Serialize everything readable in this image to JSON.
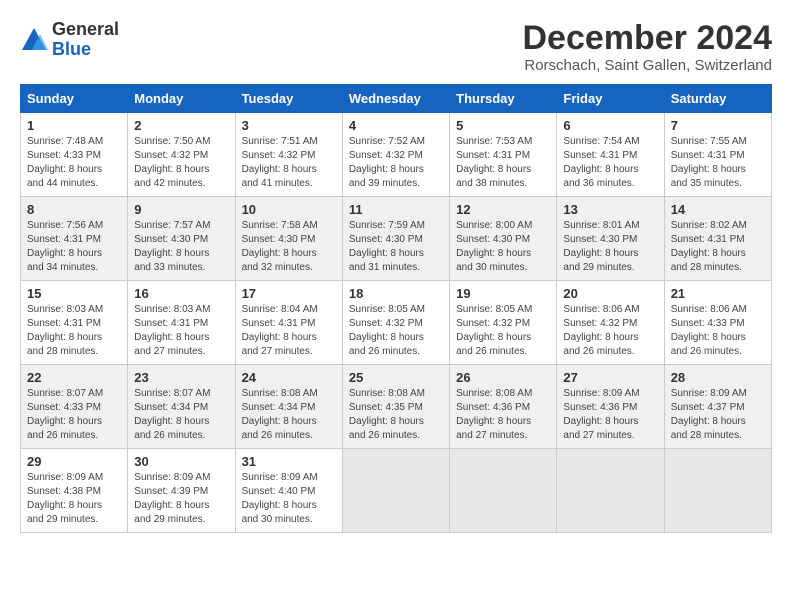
{
  "logo": {
    "general": "General",
    "blue": "Blue"
  },
  "header": {
    "month_title": "December 2024",
    "location": "Rorschach, Saint Gallen, Switzerland"
  },
  "days_of_week": [
    "Sunday",
    "Monday",
    "Tuesday",
    "Wednesday",
    "Thursday",
    "Friday",
    "Saturday"
  ],
  "weeks": [
    {
      "days": [
        {
          "num": "1",
          "sunrise": "7:48 AM",
          "sunset": "4:33 PM",
          "daylight": "8 hours and 44 minutes."
        },
        {
          "num": "2",
          "sunrise": "7:50 AM",
          "sunset": "4:32 PM",
          "daylight": "8 hours and 42 minutes."
        },
        {
          "num": "3",
          "sunrise": "7:51 AM",
          "sunset": "4:32 PM",
          "daylight": "8 hours and 41 minutes."
        },
        {
          "num": "4",
          "sunrise": "7:52 AM",
          "sunset": "4:32 PM",
          "daylight": "8 hours and 39 minutes."
        },
        {
          "num": "5",
          "sunrise": "7:53 AM",
          "sunset": "4:31 PM",
          "daylight": "8 hours and 38 minutes."
        },
        {
          "num": "6",
          "sunrise": "7:54 AM",
          "sunset": "4:31 PM",
          "daylight": "8 hours and 36 minutes."
        },
        {
          "num": "7",
          "sunrise": "7:55 AM",
          "sunset": "4:31 PM",
          "daylight": "8 hours and 35 minutes."
        }
      ]
    },
    {
      "days": [
        {
          "num": "8",
          "sunrise": "7:56 AM",
          "sunset": "4:31 PM",
          "daylight": "8 hours and 34 minutes."
        },
        {
          "num": "9",
          "sunrise": "7:57 AM",
          "sunset": "4:30 PM",
          "daylight": "8 hours and 33 minutes."
        },
        {
          "num": "10",
          "sunrise": "7:58 AM",
          "sunset": "4:30 PM",
          "daylight": "8 hours and 32 minutes."
        },
        {
          "num": "11",
          "sunrise": "7:59 AM",
          "sunset": "4:30 PM",
          "daylight": "8 hours and 31 minutes."
        },
        {
          "num": "12",
          "sunrise": "8:00 AM",
          "sunset": "4:30 PM",
          "daylight": "8 hours and 30 minutes."
        },
        {
          "num": "13",
          "sunrise": "8:01 AM",
          "sunset": "4:30 PM",
          "daylight": "8 hours and 29 minutes."
        },
        {
          "num": "14",
          "sunrise": "8:02 AM",
          "sunset": "4:31 PM",
          "daylight": "8 hours and 28 minutes."
        }
      ]
    },
    {
      "days": [
        {
          "num": "15",
          "sunrise": "8:03 AM",
          "sunset": "4:31 PM",
          "daylight": "8 hours and 28 minutes."
        },
        {
          "num": "16",
          "sunrise": "8:03 AM",
          "sunset": "4:31 PM",
          "daylight": "8 hours and 27 minutes."
        },
        {
          "num": "17",
          "sunrise": "8:04 AM",
          "sunset": "4:31 PM",
          "daylight": "8 hours and 27 minutes."
        },
        {
          "num": "18",
          "sunrise": "8:05 AM",
          "sunset": "4:32 PM",
          "daylight": "8 hours and 26 minutes."
        },
        {
          "num": "19",
          "sunrise": "8:05 AM",
          "sunset": "4:32 PM",
          "daylight": "8 hours and 26 minutes."
        },
        {
          "num": "20",
          "sunrise": "8:06 AM",
          "sunset": "4:32 PM",
          "daylight": "8 hours and 26 minutes."
        },
        {
          "num": "21",
          "sunrise": "8:06 AM",
          "sunset": "4:33 PM",
          "daylight": "8 hours and 26 minutes."
        }
      ]
    },
    {
      "days": [
        {
          "num": "22",
          "sunrise": "8:07 AM",
          "sunset": "4:33 PM",
          "daylight": "8 hours and 26 minutes."
        },
        {
          "num": "23",
          "sunrise": "8:07 AM",
          "sunset": "4:34 PM",
          "daylight": "8 hours and 26 minutes."
        },
        {
          "num": "24",
          "sunrise": "8:08 AM",
          "sunset": "4:34 PM",
          "daylight": "8 hours and 26 minutes."
        },
        {
          "num": "25",
          "sunrise": "8:08 AM",
          "sunset": "4:35 PM",
          "daylight": "8 hours and 26 minutes."
        },
        {
          "num": "26",
          "sunrise": "8:08 AM",
          "sunset": "4:36 PM",
          "daylight": "8 hours and 27 minutes."
        },
        {
          "num": "27",
          "sunrise": "8:09 AM",
          "sunset": "4:36 PM",
          "daylight": "8 hours and 27 minutes."
        },
        {
          "num": "28",
          "sunrise": "8:09 AM",
          "sunset": "4:37 PM",
          "daylight": "8 hours and 28 minutes."
        }
      ]
    },
    {
      "days": [
        {
          "num": "29",
          "sunrise": "8:09 AM",
          "sunset": "4:38 PM",
          "daylight": "8 hours and 29 minutes."
        },
        {
          "num": "30",
          "sunrise": "8:09 AM",
          "sunset": "4:39 PM",
          "daylight": "8 hours and 29 minutes."
        },
        {
          "num": "31",
          "sunrise": "8:09 AM",
          "sunset": "4:40 PM",
          "daylight": "8 hours and 30 minutes."
        },
        null,
        null,
        null,
        null
      ]
    }
  ],
  "labels": {
    "sunrise_prefix": "Sunrise: ",
    "sunset_prefix": "Sunset: ",
    "daylight_prefix": "Daylight: "
  }
}
